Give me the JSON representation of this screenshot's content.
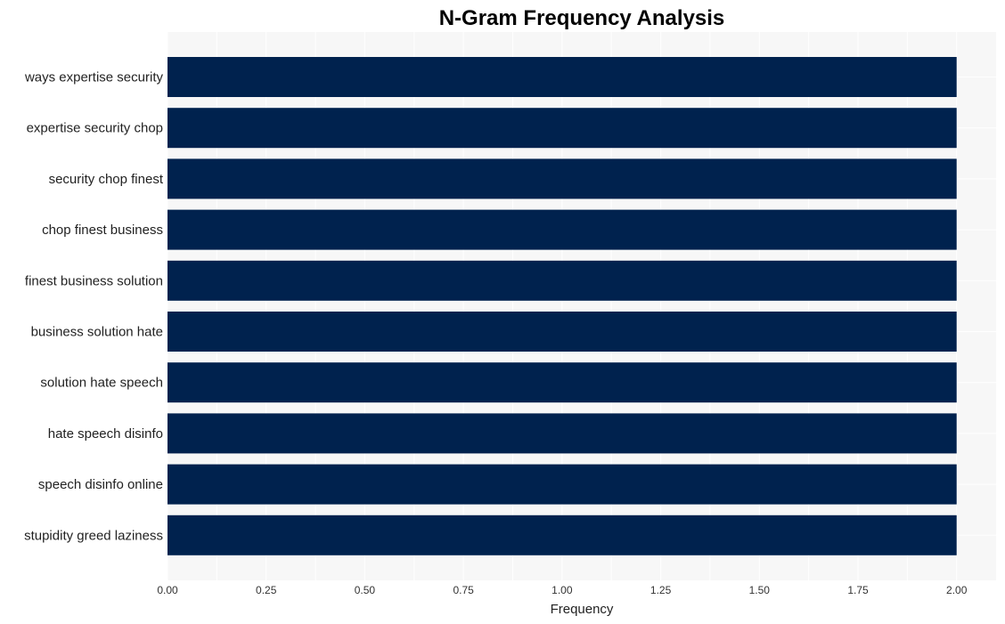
{
  "chart_data": {
    "type": "bar",
    "orientation": "horizontal",
    "title": "N-Gram Frequency Analysis",
    "xlabel": "Frequency",
    "ylabel": "",
    "categories": [
      "ways expertise security",
      "expertise security chop",
      "security chop finest",
      "chop finest business",
      "finest business solution",
      "business solution hate",
      "solution hate speech",
      "hate speech disinfo",
      "speech disinfo online",
      "stupidity greed laziness"
    ],
    "values": [
      2,
      2,
      2,
      2,
      2,
      2,
      2,
      2,
      2,
      2
    ],
    "xlim": [
      0,
      2.1
    ],
    "xticks": [
      0,
      0.25,
      0.5,
      0.75,
      1.0,
      1.25,
      1.5,
      1.75,
      2.0
    ],
    "xtick_labels": [
      "0.00",
      "0.25",
      "0.50",
      "0.75",
      "1.00",
      "1.25",
      "1.50",
      "1.75",
      "2.00"
    ],
    "grid": true,
    "legend": "none",
    "colors": {
      "bar": "#00224e",
      "plot_background": "#f7f7f7",
      "grid": "#ffffff"
    }
  }
}
